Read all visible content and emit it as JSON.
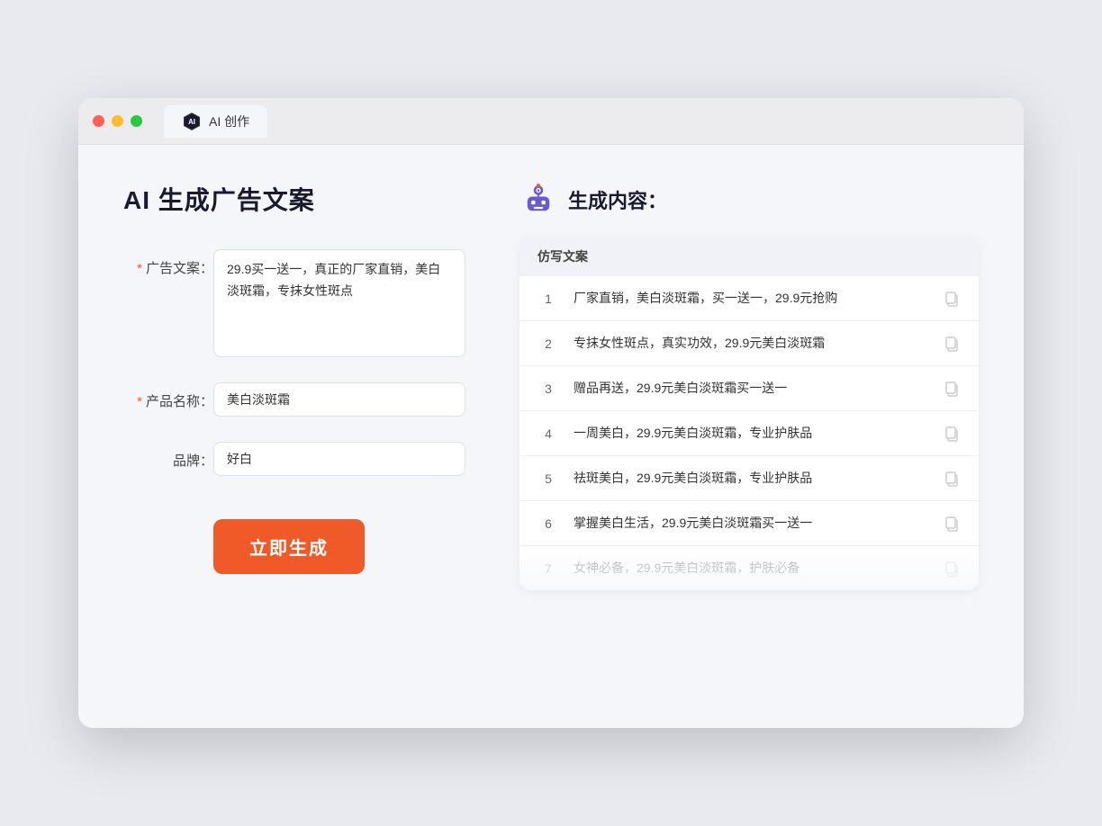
{
  "browser": {
    "tab_title": "AI 创作"
  },
  "page": {
    "title": "AI 生成广告文案",
    "result_header": "生成内容："
  },
  "form": {
    "ad_label": "广告文案：",
    "ad_required": "*",
    "ad_value": "29.9买一送一，真正的厂家直销，美白淡斑霜，专抹女性斑点",
    "product_label": "产品名称：",
    "product_required": "*",
    "product_value": "美白淡斑霜",
    "brand_label": "品牌：",
    "brand_value": "好白",
    "generate_btn": "立即生成"
  },
  "results": {
    "header_label": "仿写文案",
    "items": [
      {
        "num": "1",
        "text": "厂家直销，美白淡斑霜，买一送一，29.9元抢购"
      },
      {
        "num": "2",
        "text": "专抹女性斑点，真实功效，29.9元美白淡斑霜"
      },
      {
        "num": "3",
        "text": "赠品再送，29.9元美白淡斑霜买一送一"
      },
      {
        "num": "4",
        "text": "一周美白，29.9元美白淡斑霜，专业护肤品"
      },
      {
        "num": "5",
        "text": "祛斑美白，29.9元美白淡斑霜，专业护肤品"
      },
      {
        "num": "6",
        "text": "掌握美白生活，29.9元美白淡斑霜买一送一"
      },
      {
        "num": "7",
        "text": "女神必备，29.9元美白淡斑霜，护肤必备",
        "faded": true
      }
    ]
  }
}
